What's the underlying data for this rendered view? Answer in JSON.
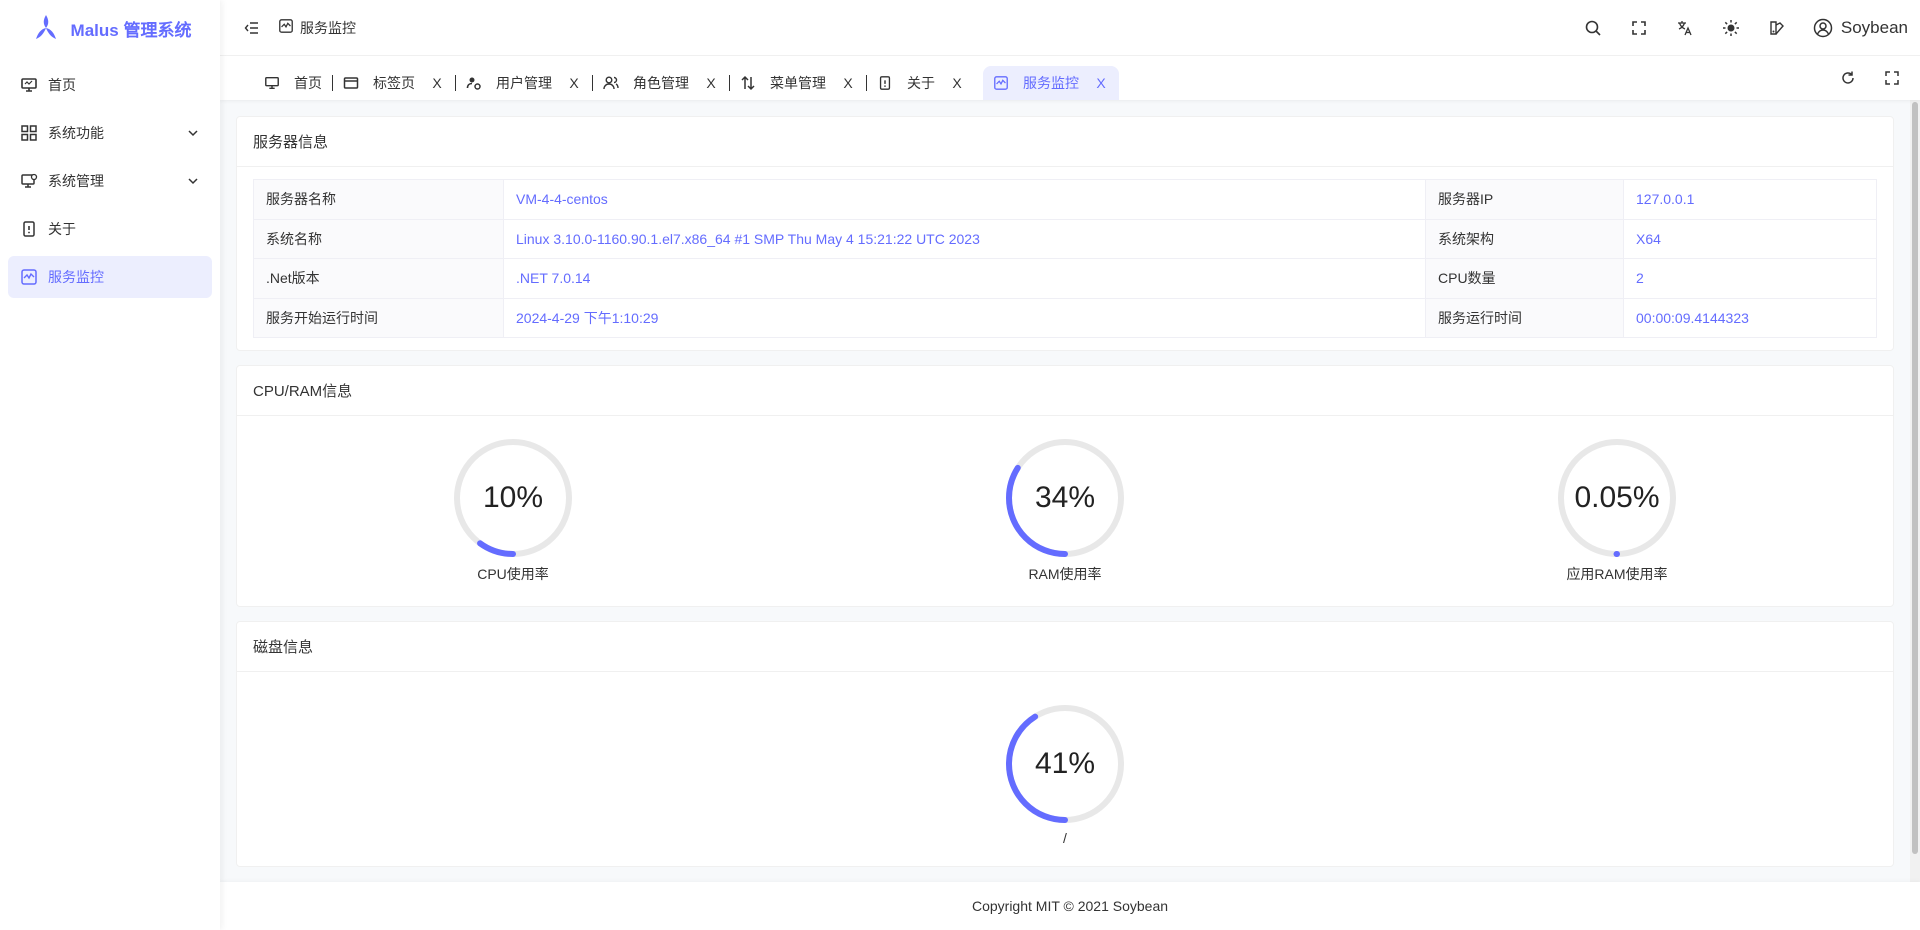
{
  "app": {
    "title": "Malus 管理系统"
  },
  "sidebar": {
    "items": [
      {
        "label": "首页",
        "icon": "monitor-icon",
        "active": false,
        "expandable": false
      },
      {
        "label": "系统功能",
        "icon": "grid-icon",
        "active": false,
        "expandable": true
      },
      {
        "label": "系统管理",
        "icon": "monitor-settings-icon",
        "active": false,
        "expandable": true
      },
      {
        "label": "关于",
        "icon": "info-icon",
        "active": false,
        "expandable": false
      },
      {
        "label": "服务监控",
        "icon": "activity-icon",
        "active": true,
        "expandable": false
      }
    ]
  },
  "header": {
    "breadcrumb": "服务监控",
    "user": "Soybean"
  },
  "tabs": [
    {
      "label": "首页",
      "icon": "monitor-icon",
      "closable": false,
      "active": false
    },
    {
      "label": "标签页",
      "icon": "window-icon",
      "closable": true,
      "active": false
    },
    {
      "label": "用户管理",
      "icon": "user-gear-icon",
      "closable": true,
      "active": false
    },
    {
      "label": "角色管理",
      "icon": "users-icon",
      "closable": true,
      "active": false
    },
    {
      "label": "菜单管理",
      "icon": "sort-icon",
      "closable": true,
      "active": false
    },
    {
      "label": "关于",
      "icon": "info-icon",
      "closable": true,
      "active": false
    },
    {
      "label": "服务监控",
      "icon": "activity-icon",
      "closable": true,
      "active": true
    }
  ],
  "tab_close_glyph": "X",
  "server": {
    "title": "服务器信息",
    "rows": [
      {
        "k1": "服务器名称",
        "v1": "VM-4-4-centos",
        "k2": "服务器IP",
        "v2": "127.0.0.1"
      },
      {
        "k1": "系统名称",
        "v1": "Linux 3.10.0-1160.90.1.el7.x86_64 #1 SMP Thu May 4 15:21:22 UTC 2023",
        "k2": "系统架构",
        "v2": "X64"
      },
      {
        "k1": ".Net版本",
        "v1": ".NET 7.0.14",
        "k2": "CPU数量",
        "v2": "2"
      },
      {
        "k1": "服务开始运行时间",
        "v1": "2024-4-29 下午1:10:29",
        "k2": "服务运行时间",
        "v2": "00:00:09.4144323"
      }
    ]
  },
  "cpu_ram": {
    "title": "CPU/RAM信息",
    "gauges": [
      {
        "value_text": "10%",
        "percent": 10,
        "label": "CPU使用率"
      },
      {
        "value_text": "34%",
        "percent": 34,
        "label": "RAM使用率"
      },
      {
        "value_text": "0.05%",
        "percent": 0.05,
        "label": "应用RAM使用率"
      }
    ]
  },
  "disk": {
    "title": "磁盘信息",
    "gauges": [
      {
        "value_text": "41%",
        "percent": 41,
        "label": "/"
      }
    ]
  },
  "footer": {
    "text": "Copyright MIT © 2021 Soybean"
  },
  "colors": {
    "accent": "#646cff",
    "track": "#e8e8e8",
    "active_bg": "#eceefe"
  }
}
